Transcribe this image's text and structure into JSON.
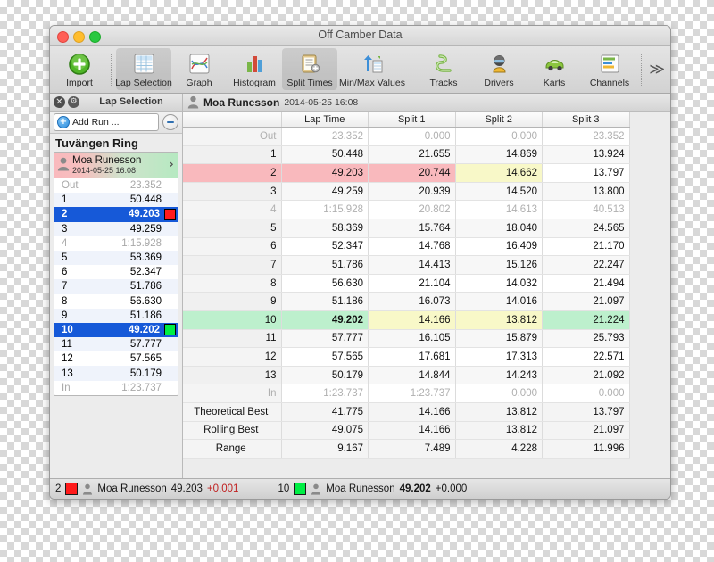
{
  "window": {
    "title": "Off Camber Data",
    "traffic_lights": [
      "close",
      "minimize",
      "zoom"
    ]
  },
  "toolbar": {
    "overflow_label": "≫",
    "items": [
      {
        "label": "Import",
        "icon": "plus-circle-green-icon",
        "selected": false
      },
      {
        "label": "Lap Selection",
        "icon": "grid-table-icon",
        "selected": true
      },
      {
        "label": "Graph",
        "icon": "line-chart-icon",
        "selected": false
      },
      {
        "label": "Histogram",
        "icon": "bar-chart-icon",
        "selected": false
      },
      {
        "label": "Split Times",
        "icon": "clipboard-icon",
        "selected": true
      },
      {
        "label": "Min/Max Values",
        "icon": "up-down-arrows-icon",
        "selected": false
      },
      {
        "label": "Tracks",
        "icon": "track-map-icon",
        "selected": false
      },
      {
        "label": "Drivers",
        "icon": "helmet-driver-icon",
        "selected": false
      },
      {
        "label": "Karts",
        "icon": "green-car-icon",
        "selected": false
      },
      {
        "label": "Channels",
        "icon": "channels-list-icon",
        "selected": false
      }
    ]
  },
  "sidebar": {
    "header_title": "Lap Selection",
    "close_icon": "close-circle-icon",
    "refresh_icon": "reload-circle-icon",
    "add_run_label": "Add Run ...",
    "add_icon": "plus-circle-blue-icon",
    "remove_icon": "minus-circle-icon",
    "track_name": "Tuvängen Ring",
    "run": {
      "driver": "Moa Runesson",
      "datetime": "2014-05-25 16:08",
      "avatar_icon": "person-icon",
      "disclosure_icon": "chevron-right-icon"
    },
    "laps": [
      {
        "num": "Out",
        "time": "23.352",
        "state": "dim",
        "swatch": null
      },
      {
        "num": "1",
        "time": "50.448",
        "state": "normal",
        "swatch": null
      },
      {
        "num": "2",
        "time": "49.203",
        "state": "selected",
        "swatch": "#ff1a1a"
      },
      {
        "num": "3",
        "time": "49.259",
        "state": "normal",
        "swatch": null
      },
      {
        "num": "4",
        "time": "1:15.928",
        "state": "dim",
        "swatch": null
      },
      {
        "num": "5",
        "time": "58.369",
        "state": "normal",
        "swatch": null
      },
      {
        "num": "6",
        "time": "52.347",
        "state": "normal",
        "swatch": null
      },
      {
        "num": "7",
        "time": "51.786",
        "state": "normal",
        "swatch": null
      },
      {
        "num": "8",
        "time": "56.630",
        "state": "normal",
        "swatch": null
      },
      {
        "num": "9",
        "time": "51.186",
        "state": "normal",
        "swatch": null
      },
      {
        "num": "10",
        "time": "49.202",
        "state": "selected",
        "swatch": "#00ee44"
      },
      {
        "num": "11",
        "time": "57.777",
        "state": "normal",
        "swatch": null
      },
      {
        "num": "12",
        "time": "57.565",
        "state": "normal",
        "swatch": null
      },
      {
        "num": "13",
        "time": "50.179",
        "state": "normal",
        "swatch": null
      },
      {
        "num": "In",
        "time": "1:23.737",
        "state": "dim",
        "swatch": null
      }
    ]
  },
  "main": {
    "header": {
      "driver": "Moa Runesson",
      "datetime": "2014-05-25 16:08",
      "avatar_icon": "person-icon"
    },
    "columns": [
      "",
      "Lap Time",
      "Split 1",
      "Split 2",
      "Split 3"
    ],
    "rows": [
      {
        "label": "Out",
        "cells": [
          "23.352",
          "0.000",
          "0.000",
          "23.352"
        ],
        "dim": true,
        "alt": false,
        "highlight": [
          "lbl",
          "white",
          "white",
          "white"
        ],
        "bold": []
      },
      {
        "label": "1",
        "cells": [
          "50.448",
          "21.655",
          "14.869",
          "13.924"
        ],
        "dim": false,
        "alt": true,
        "highlight": [
          "lbl",
          "white",
          "white",
          "white"
        ],
        "bold": []
      },
      {
        "label": "2",
        "cells": [
          "49.203",
          "20.744",
          "14.662",
          "13.797"
        ],
        "dim": false,
        "alt": false,
        "highlight": [
          "pink",
          "pink",
          "pink",
          "yellow"
        ],
        "bold": []
      },
      {
        "label": "3",
        "cells": [
          "49.259",
          "20.939",
          "14.520",
          "13.800"
        ],
        "dim": false,
        "alt": true,
        "highlight": [
          "lbl",
          "white",
          "white",
          "white"
        ],
        "bold": []
      },
      {
        "label": "4",
        "cells": [
          "1:15.928",
          "20.802",
          "14.613",
          "40.513"
        ],
        "dim": true,
        "alt": false,
        "highlight": [
          "lbl",
          "white",
          "white",
          "white"
        ],
        "bold": []
      },
      {
        "label": "5",
        "cells": [
          "58.369",
          "15.764",
          "18.040",
          "24.565"
        ],
        "dim": false,
        "alt": true,
        "highlight": [
          "lbl",
          "white",
          "white",
          "white"
        ],
        "bold": []
      },
      {
        "label": "6",
        "cells": [
          "52.347",
          "14.768",
          "16.409",
          "21.170"
        ],
        "dim": false,
        "alt": false,
        "highlight": [
          "lbl",
          "white",
          "white",
          "white"
        ],
        "bold": []
      },
      {
        "label": "7",
        "cells": [
          "51.786",
          "14.413",
          "15.126",
          "22.247"
        ],
        "dim": false,
        "alt": true,
        "highlight": [
          "lbl",
          "white",
          "white",
          "white"
        ],
        "bold": []
      },
      {
        "label": "8",
        "cells": [
          "56.630",
          "21.104",
          "14.032",
          "21.494"
        ],
        "dim": false,
        "alt": false,
        "highlight": [
          "lbl",
          "white",
          "white",
          "white"
        ],
        "bold": []
      },
      {
        "label": "9",
        "cells": [
          "51.186",
          "16.073",
          "14.016",
          "21.097"
        ],
        "dim": false,
        "alt": true,
        "highlight": [
          "lbl",
          "white",
          "white",
          "purple"
        ],
        "bold": []
      },
      {
        "label": "10",
        "cells": [
          "49.202",
          "14.166",
          "13.812",
          "21.224"
        ],
        "dim": false,
        "alt": false,
        "highlight": [
          "green",
          "green",
          "yellow",
          "yellow",
          "green"
        ],
        "bold": [
          0
        ]
      },
      {
        "label": "11",
        "cells": [
          "57.777",
          "16.105",
          "15.879",
          "25.793"
        ],
        "dim": false,
        "alt": true,
        "highlight": [
          "lbl",
          "white",
          "white",
          "white"
        ],
        "bold": []
      },
      {
        "label": "12",
        "cells": [
          "57.565",
          "17.681",
          "17.313",
          "22.571"
        ],
        "dim": false,
        "alt": false,
        "highlight": [
          "lbl",
          "white",
          "white",
          "white"
        ],
        "bold": []
      },
      {
        "label": "13",
        "cells": [
          "50.179",
          "14.844",
          "14.243",
          "21.092"
        ],
        "dim": false,
        "alt": true,
        "highlight": [
          "lbl",
          "white",
          "white",
          "white"
        ],
        "bold": []
      },
      {
        "label": "In",
        "cells": [
          "1:23.737",
          "1:23.737",
          "0.000",
          "0.000"
        ],
        "dim": true,
        "alt": false,
        "highlight": [
          "lbl",
          "white",
          "white",
          "white"
        ],
        "bold": []
      }
    ],
    "summary_rows": [
      {
        "label": "Theoretical Best",
        "cells": [
          "41.775",
          "14.166",
          "13.812",
          "13.797"
        ],
        "highlight": [
          "lbl",
          "yellow",
          "yellow",
          "yellow"
        ]
      },
      {
        "label": "Rolling Best",
        "cells": [
          "49.075",
          "14.166",
          "13.812",
          "21.097"
        ],
        "highlight": [
          "lbl",
          "purple",
          "purple",
          "purple"
        ]
      },
      {
        "label": "Range",
        "cells": [
          "9.167",
          "7.489",
          "4.228",
          "11.996"
        ],
        "highlight": [
          "lbl",
          "white",
          "white",
          "white"
        ]
      }
    ]
  },
  "statusbar": {
    "entries": [
      {
        "lap": "2",
        "swatch": "#ff1a1a",
        "avatar_icon": "person-icon",
        "driver": "Moa Runesson",
        "time": "49.203",
        "delta": "+0.001",
        "delta_kind": "positive",
        "bold_time": false
      },
      {
        "lap": "10",
        "swatch": "#00ee44",
        "avatar_icon": "person-icon",
        "driver": "Moa Runesson",
        "time": "49.202",
        "delta": "+0.000",
        "delta_kind": "zero",
        "bold_time": true
      }
    ]
  },
  "colors": {
    "selection_blue": "#1659d8",
    "pink": "#f9b9bd",
    "yellow": "#f8f8c8",
    "green": "#bdf0cd",
    "purple": "#ccccf2",
    "delta_positive": "#c02020"
  }
}
